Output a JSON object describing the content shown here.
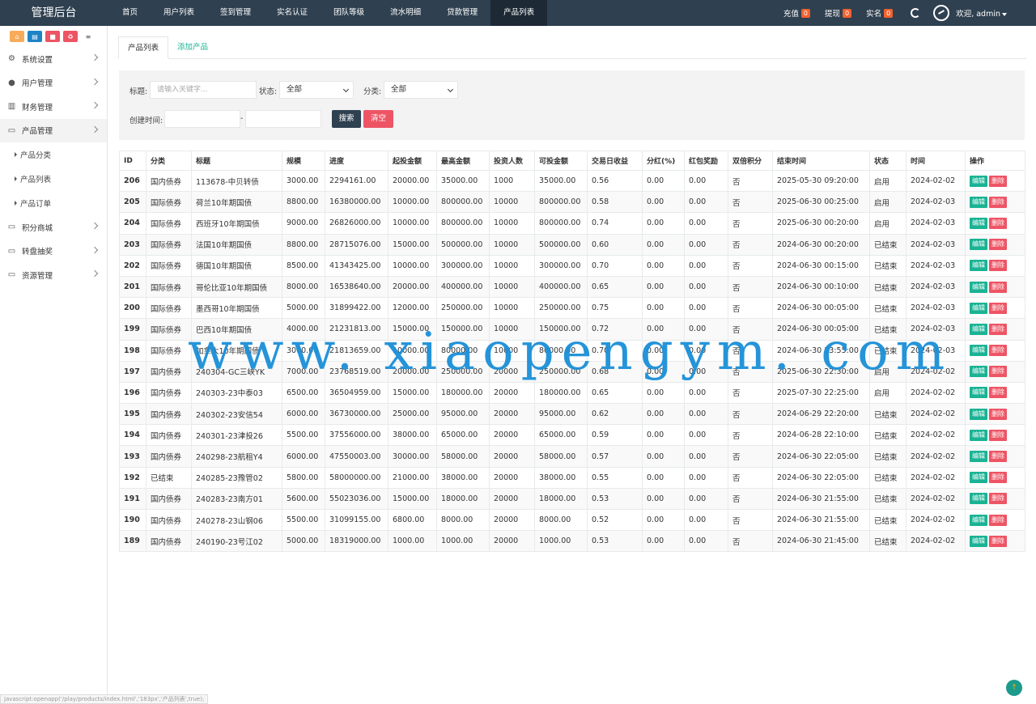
{
  "brand": "管理后台",
  "nav": [
    {
      "label": "首页",
      "active": false
    },
    {
      "label": "用户列表",
      "active": false
    },
    {
      "label": "签到管理",
      "active": false
    },
    {
      "label": "实名认证",
      "active": false
    },
    {
      "label": "团队等级",
      "active": false
    },
    {
      "label": "流水明细",
      "active": false
    },
    {
      "label": "贷款管理",
      "active": false
    },
    {
      "label": "产品列表",
      "active": true
    }
  ],
  "topright": {
    "items": [
      {
        "label": "充值",
        "badge": "0"
      },
      {
        "label": "提现",
        "badge": "0"
      },
      {
        "label": "实名",
        "badge": "0"
      }
    ],
    "user": "欢迎, admin"
  },
  "sidebar": {
    "tools": [
      {
        "icon": "home-icon",
        "glyph": "⌂",
        "color": "#f8ac59"
      },
      {
        "icon": "file-icon",
        "glyph": "▤",
        "color": "#1c84c6"
      },
      {
        "icon": "trash-icon",
        "glyph": "■",
        "color": "#ed5565"
      },
      {
        "icon": "recycle-icon",
        "glyph": "♻",
        "color": "#ed5565"
      },
      {
        "icon": "list-icon",
        "glyph": "≡",
        "color": "#ffffff"
      }
    ],
    "items": [
      {
        "label": "系统设置",
        "icon": "gears-icon",
        "glyph": "⚙"
      },
      {
        "label": "用户管理",
        "icon": "user-icon",
        "glyph": "●"
      },
      {
        "label": "财务管理",
        "icon": "database-icon",
        "glyph": "▥"
      },
      {
        "label": "产品管理",
        "icon": "desktop-icon",
        "glyph": "▭",
        "active": true,
        "children": [
          "产品分类",
          "产品列表",
          "产品订单"
        ]
      },
      {
        "label": "积分商城",
        "icon": "desktop-icon",
        "glyph": "▭"
      },
      {
        "label": "转盘抽奖",
        "icon": "desktop-icon",
        "glyph": "▭"
      },
      {
        "label": "资源管理",
        "icon": "desktop-icon",
        "glyph": "▭"
      }
    ]
  },
  "tabs": [
    {
      "label": "产品列表",
      "active": true
    },
    {
      "label": "添加产品",
      "active": false
    }
  ],
  "filter": {
    "title_label": "标题:",
    "title_placeholder": "请输入关键字...",
    "status_label": "状态:",
    "status_value": "全部",
    "category_label": "分类:",
    "category_value": "全部",
    "created_label": "创建时间:",
    "range_sep": "-",
    "search_btn": "搜索",
    "clear_btn": "清空"
  },
  "table": {
    "columns": [
      "ID",
      "分类",
      "标题",
      "规模",
      "进度",
      "起投金额",
      "最高金额",
      "投资人数",
      "可投金额",
      "交易日收益",
      "分红(%)",
      "红包奖励",
      "双倍积分",
      "结束时间",
      "状态",
      "时间",
      "操作"
    ],
    "edit_label": "编辑",
    "delete_label": "删除",
    "rows": [
      [
        "206",
        "国内债券",
        "113678-中贝转债",
        "3000.00",
        "2294161.00",
        "20000.00",
        "35000.00",
        "1000",
        "35000.00",
        "0.56",
        "0.00",
        "0.00",
        "否",
        "2025-05-30 09:20:00",
        "启用",
        "2024-02-02"
      ],
      [
        "205",
        "国际债券",
        "荷兰10年期国债",
        "8800.00",
        "16380000.00",
        "10000.00",
        "800000.00",
        "10000",
        "800000.00",
        "0.58",
        "0.00",
        "0.00",
        "否",
        "2025-06-30 00:25:00",
        "启用",
        "2024-02-03"
      ],
      [
        "204",
        "国际债券",
        "西班牙10年期国债",
        "9000.00",
        "26826000.00",
        "10000.00",
        "800000.00",
        "10000",
        "800000.00",
        "0.74",
        "0.00",
        "0.00",
        "否",
        "2025-06-30 00:20:00",
        "启用",
        "2024-02-03"
      ],
      [
        "203",
        "国际债券",
        "法国10年期国债",
        "8800.00",
        "28715076.00",
        "15000.00",
        "500000.00",
        "10000",
        "500000.00",
        "0.60",
        "0.00",
        "0.00",
        "否",
        "2024-06-30 00:20:00",
        "已结束",
        "2024-02-03"
      ],
      [
        "202",
        "国际债券",
        "德国10年期国债",
        "8500.00",
        "41343425.00",
        "10000.00",
        "300000.00",
        "10000",
        "300000.00",
        "0.70",
        "0.00",
        "0.00",
        "否",
        "2024-06-30 00:15:00",
        "已结束",
        "2024-02-03"
      ],
      [
        "201",
        "国际债券",
        "哥伦比亚10年期国债",
        "8000.00",
        "16538640.00",
        "20000.00",
        "400000.00",
        "10000",
        "400000.00",
        "0.65",
        "0.00",
        "0.00",
        "否",
        "2024-06-30 00:10:00",
        "已结束",
        "2024-02-03"
      ],
      [
        "200",
        "国际债券",
        "墨西哥10年期国债",
        "5000.00",
        "31899422.00",
        "12000.00",
        "250000.00",
        "10000",
        "250000.00",
        "0.75",
        "0.00",
        "0.00",
        "否",
        "2024-06-30 00:05:00",
        "已结束",
        "2024-02-03"
      ],
      [
        "199",
        "国际债券",
        "巴西10年期国债",
        "4000.00",
        "21231813.00",
        "15000.00",
        "150000.00",
        "10000",
        "150000.00",
        "0.72",
        "0.00",
        "0.00",
        "否",
        "2024-06-30 00:05:00",
        "已结束",
        "2024-02-03"
      ],
      [
        "198",
        "国际债券",
        "加拿大10年期国债",
        "3000.00",
        "21813659.00",
        "10000.00",
        "80000.00",
        "10000",
        "80000.00",
        "0.70",
        "0.00",
        "0.00",
        "否",
        "2024-06-30 23:55:00",
        "已结束",
        "2024-02-03"
      ],
      [
        "197",
        "国内债券",
        "240304-GC三峡YK",
        "7000.00",
        "23768519.00",
        "20000.00",
        "250000.00",
        "20000",
        "250000.00",
        "0.68",
        "0.00",
        "0.00",
        "否",
        "2025-06-30 22:30:00",
        "启用",
        "2024-02-02"
      ],
      [
        "196",
        "国内债券",
        "240303-23中泰03",
        "6500.00",
        "36504959.00",
        "15000.00",
        "180000.00",
        "20000",
        "180000.00",
        "0.65",
        "0.00",
        "0.00",
        "否",
        "2025-07-30 22:25:00",
        "启用",
        "2024-02-02"
      ],
      [
        "195",
        "国内债券",
        "240302-23安信54",
        "6000.00",
        "36730000.00",
        "25000.00",
        "95000.00",
        "20000",
        "95000.00",
        "0.62",
        "0.00",
        "0.00",
        "否",
        "2024-06-29 22:20:00",
        "已结束",
        "2024-02-02"
      ],
      [
        "194",
        "国内债券",
        "240301-23津投26",
        "5500.00",
        "37556000.00",
        "38000.00",
        "65000.00",
        "20000",
        "65000.00",
        "0.59",
        "0.00",
        "0.00",
        "否",
        "2024-06-28 22:10:00",
        "已结束",
        "2024-02-02"
      ],
      [
        "193",
        "国内债券",
        "240298-23航租Y4",
        "6000.00",
        "47550003.00",
        "30000.00",
        "58000.00",
        "20000",
        "58000.00",
        "0.57",
        "0.00",
        "0.00",
        "否",
        "2024-06-30 22:05:00",
        "已结束",
        "2024-02-02"
      ],
      [
        "192",
        "已结束",
        "240285-23豫管02",
        "5800.00",
        "58000000.00",
        "21000.00",
        "38000.00",
        "20000",
        "38000.00",
        "0.55",
        "0.00",
        "0.00",
        "否",
        "2024-06-30 22:05:00",
        "已结束",
        "2024-02-02"
      ],
      [
        "191",
        "国内债券",
        "240283-23南方01",
        "5600.00",
        "55023036.00",
        "15000.00",
        "18000.00",
        "20000",
        "18000.00",
        "0.53",
        "0.00",
        "0.00",
        "否",
        "2024-06-30 21:55:00",
        "已结束",
        "2024-02-02"
      ],
      [
        "190",
        "国内债券",
        "240278-23山钢06",
        "5500.00",
        "31099155.00",
        "6800.00",
        "8000.00",
        "20000",
        "8000.00",
        "0.52",
        "0.00",
        "0.00",
        "否",
        "2024-06-30 21:55:00",
        "已结束",
        "2024-02-02"
      ],
      [
        "189",
        "国内债券",
        "240190-23号江02",
        "5000.00",
        "18319000.00",
        "1000.00",
        "1000.00",
        "20000",
        "1000.00",
        "0.53",
        "0.00",
        "0.00",
        "否",
        "2024-06-30 21:45:00",
        "已结束",
        "2024-02-02"
      ]
    ]
  },
  "watermark": "www. xiaopengym. com",
  "statusbar": "javascript:openapp('/play/products/index.html','183px','产品列表',true);",
  "fab_glyph": "↑",
  "colors": {
    "topbar": "#2f4050",
    "accent": "#1ab394",
    "danger": "#ed5565",
    "dark_button": "#2f4050",
    "badge": "#f0622f"
  }
}
